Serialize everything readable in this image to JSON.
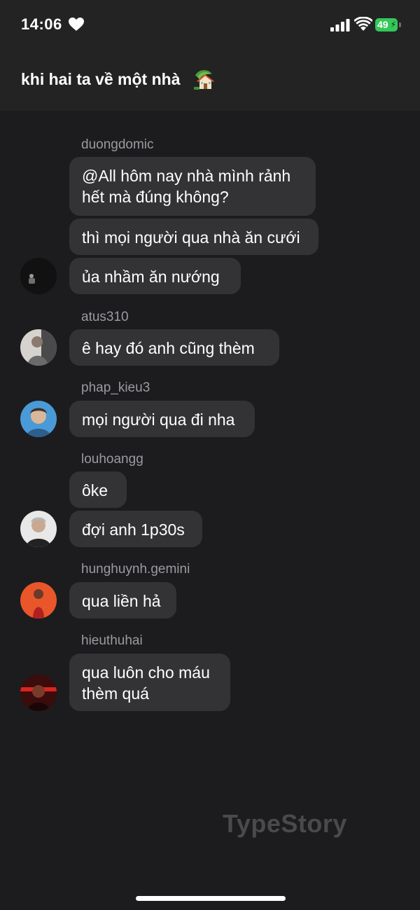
{
  "status_bar": {
    "time": "14:06",
    "battery": "49"
  },
  "header": {
    "title": "khi hai ta về một nhà"
  },
  "messages": [
    {
      "sender": "duongdomic",
      "bubbles": [
        "@All hôm nay nhà mình rảnh\nhết mà đúng không?",
        "thì mọi người qua nhà ăn cưới",
        "ủa nhầm ăn nướng"
      ]
    },
    {
      "sender": "atus310",
      "bubbles": [
        "ê hay đó anh cũng thèm"
      ]
    },
    {
      "sender": "phap_kieu3",
      "bubbles": [
        "mọi người qua đi nha"
      ]
    },
    {
      "sender": "louhoangg",
      "bubbles": [
        "ôke",
        "đợi anh 1p30s"
      ]
    },
    {
      "sender": "hunghuynh.gemini",
      "bubbles": [
        "qua liền hả"
      ]
    },
    {
      "sender": "hieuthuhai",
      "bubbles": [
        "qua luôn cho máu\nthèm quá"
      ]
    }
  ],
  "watermark": "TypeStory",
  "colors": {
    "background": "#1c1c1e",
    "header": "#232323",
    "bubble": "#333335",
    "sender": "#9b9ba0",
    "battery": "#34c759"
  }
}
